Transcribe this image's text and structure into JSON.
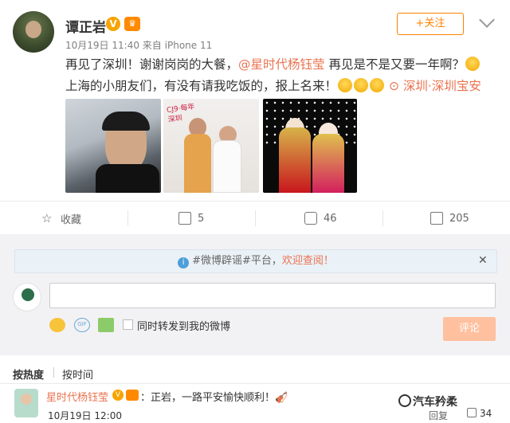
{
  "post": {
    "author": "谭正岩",
    "verified_badge": "V",
    "vip_badge": "♛",
    "date": "10月19日",
    "time": "11:40",
    "source_prefix": "来自",
    "source": "iPhone 11",
    "follow_label": "+关注",
    "text_part1": "再见了深圳！谢谢岗岗的大餐，",
    "mention": "@星时代杨钰莹",
    "text_part2": " 再见是不是又要一年啊？",
    "text_part3": "上海的小朋友们，有没有请我吃饭的，报上名来！",
    "location": "深圳·深圳宝安机场",
    "image2_sign": "CJ9·每年 深圳"
  },
  "actions": {
    "favorite_label": "收藏",
    "repost_count": "5",
    "comment_count": "46",
    "like_count": "205"
  },
  "notice": {
    "info_glyph": "i",
    "prefix": "#微博辟谣#平台，",
    "highlight": "欢迎查阅！",
    "close": "✕"
  },
  "composer": {
    "input_value": "",
    "gif_label": "GIF",
    "also_repost_label": "同时转发到我的微博",
    "submit_label": "评论"
  },
  "sort": {
    "hot_label": "按热度",
    "time_label": "按时间"
  },
  "comment": {
    "author": "星时代杨钰莹",
    "verified_badge": "V",
    "text": "：正岩，一路平安愉快顺利！🎻",
    "date": "10月19日",
    "time": "12:00",
    "reply_label": "回复",
    "like_count": "34"
  },
  "watermark": {
    "text": "汽车矜柔"
  },
  "colors": {
    "accent": "#eb7350",
    "follow": "#ff8200",
    "verified": "#f7a400",
    "notice_bg": "#eaf1f7",
    "submit_disabled": "#ffc09f"
  }
}
